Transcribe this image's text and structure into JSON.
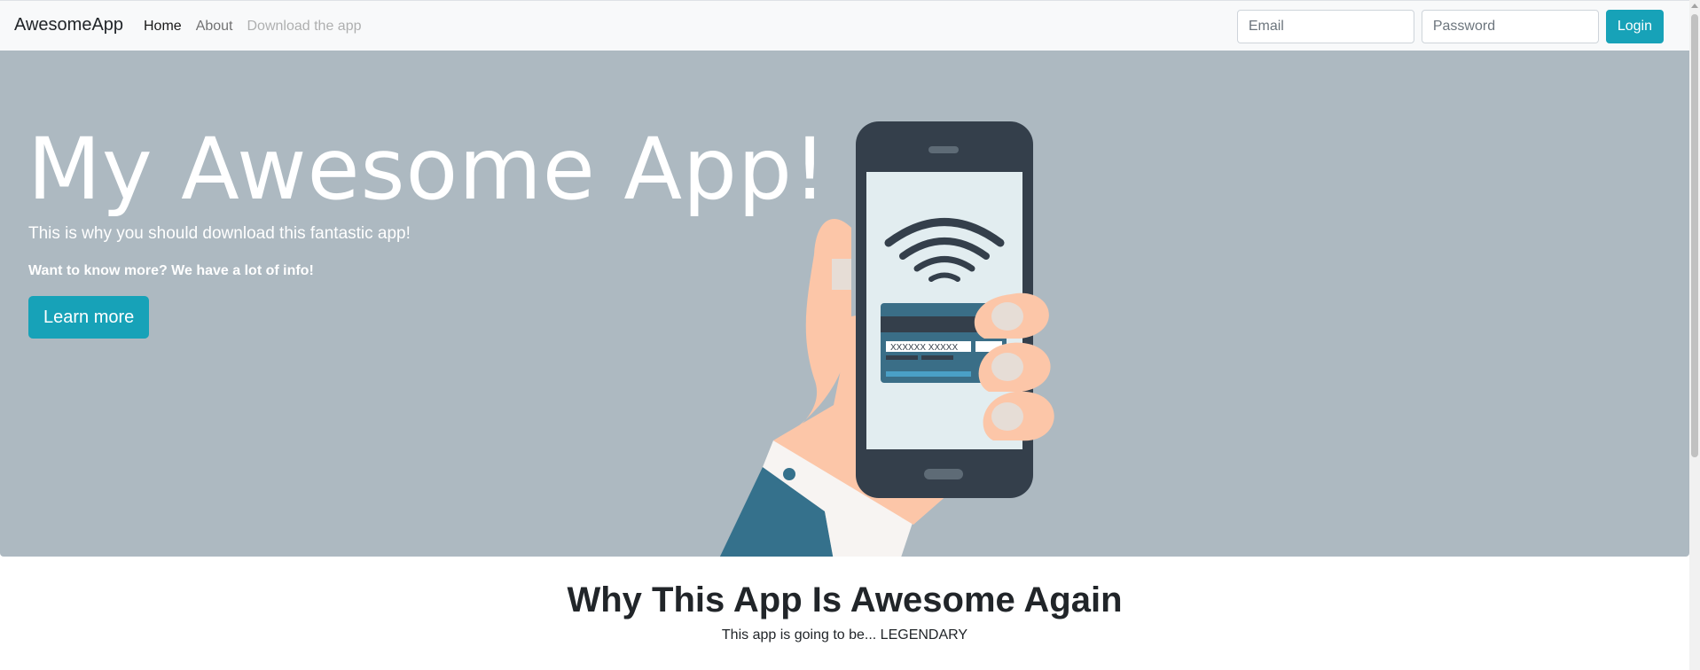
{
  "navbar": {
    "brand": "AwesomeApp",
    "links": [
      "Home",
      "About",
      "Download the app"
    ],
    "email_placeholder": "Email",
    "password_placeholder": "Password",
    "login_label": "Login"
  },
  "hero": {
    "title": "My Awesome App!",
    "lead": "This is why you should download this fantastic app!",
    "more": "Want to know more? We have a lot of info!",
    "button_label": "Learn more",
    "card_text": "XXXXXX XXXXX"
  },
  "section": {
    "title": "Why This App Is Awesome Again",
    "subtitle": "This app is going to be... LEGENDARY"
  },
  "colors": {
    "accent": "#17a2b8",
    "hero_background": "#adb9c1",
    "navbar_background": "#f8f9fa"
  }
}
